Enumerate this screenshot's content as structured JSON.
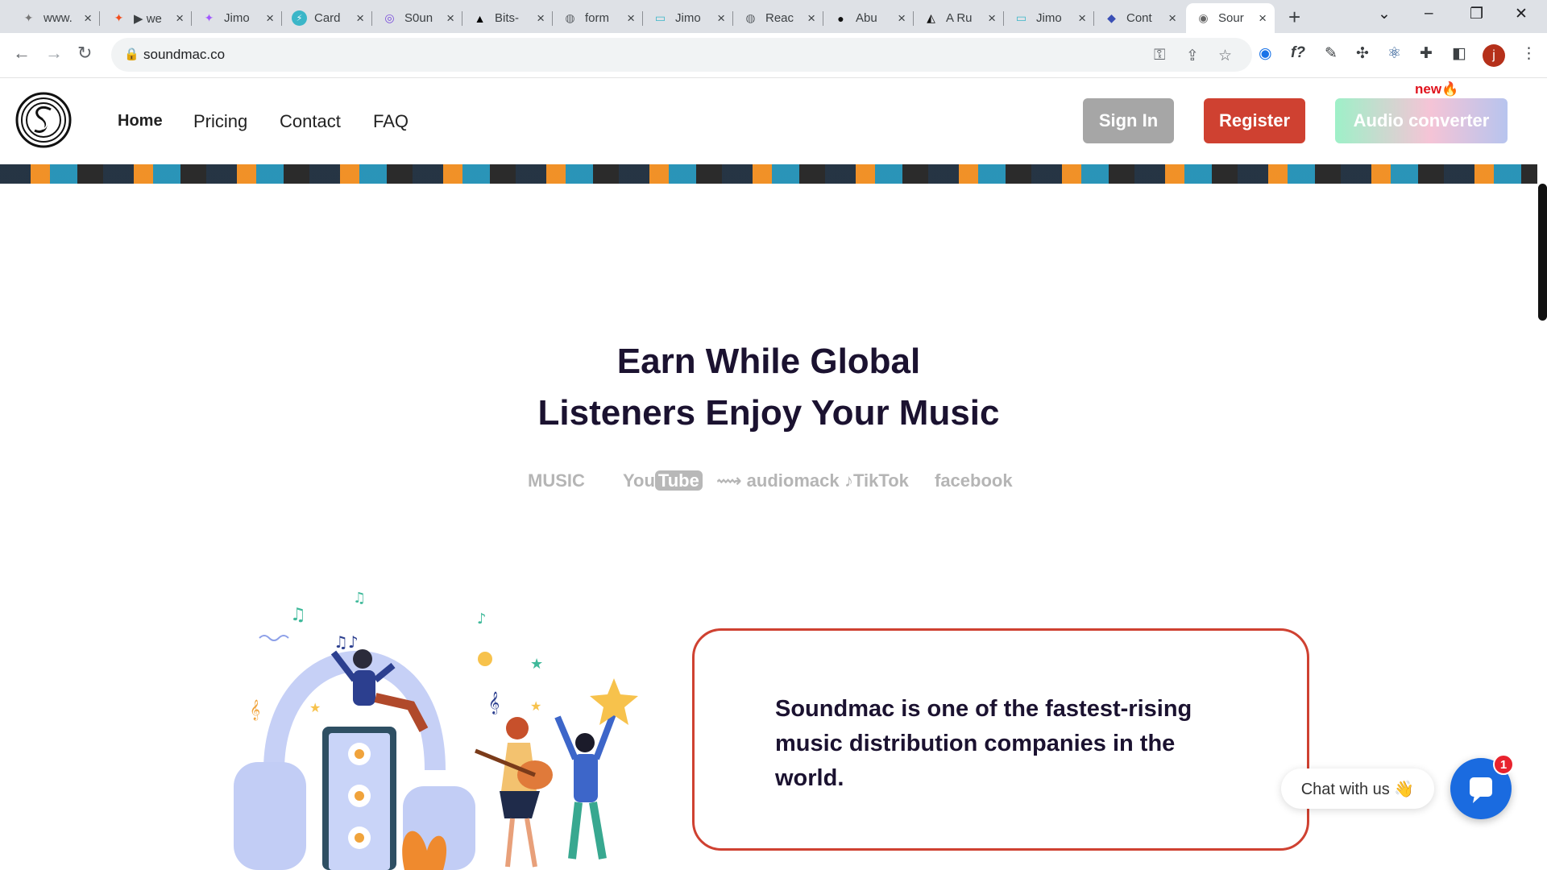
{
  "browser": {
    "tabs": [
      {
        "title": "www.",
        "icon": "figma-gray-icon"
      },
      {
        "title": "▶ we",
        "icon": "figma-icon"
      },
      {
        "title": "Jimo",
        "icon": "figma-icon"
      },
      {
        "title": "Card",
        "icon": "lightning-icon"
      },
      {
        "title": "S0un",
        "icon": "spiral-icon"
      },
      {
        "title": "Bits-",
        "icon": "triangle-icon"
      },
      {
        "title": "form",
        "icon": "globe-icon"
      },
      {
        "title": "Jimo",
        "icon": "window-icon"
      },
      {
        "title": "Reac",
        "icon": "globe-icon"
      },
      {
        "title": "Abu",
        "icon": "github-icon"
      },
      {
        "title": "A Ru",
        "icon": "circle-triangle-icon"
      },
      {
        "title": "Jimo",
        "icon": "window-icon"
      },
      {
        "title": "Cont",
        "icon": "app-icon"
      },
      {
        "title": "Sour",
        "icon": "soundmac-icon"
      }
    ],
    "url": "soundmac.co",
    "profile_initial": "j"
  },
  "header": {
    "nav": {
      "home": "Home",
      "pricing": "Pricing",
      "contact": "Contact",
      "faq": "FAQ"
    },
    "signin": "Sign In",
    "register": "Register",
    "converter": "Audio converter",
    "new_badge": "new"
  },
  "hero": {
    "title_line1": "Earn While Global",
    "title_line2": "Listeners Enjoy Your Music"
  },
  "platforms": {
    "apple": "MUSIC",
    "youtube_a": "You",
    "youtube_b": "Tube",
    "audiomack": "audiomack",
    "tiktok": "TikTok",
    "facebook": "facebook"
  },
  "card": {
    "text": "Soundmac is one of the fastest-rising music distribution companies in the world."
  },
  "chat": {
    "label": "Chat with us 👋",
    "badge": "1"
  },
  "colors": {
    "accent_red": "#cf4131",
    "signin_gray": "#a6a6a6",
    "heading": "#1b1230",
    "chat_blue": "#1a6be0"
  }
}
